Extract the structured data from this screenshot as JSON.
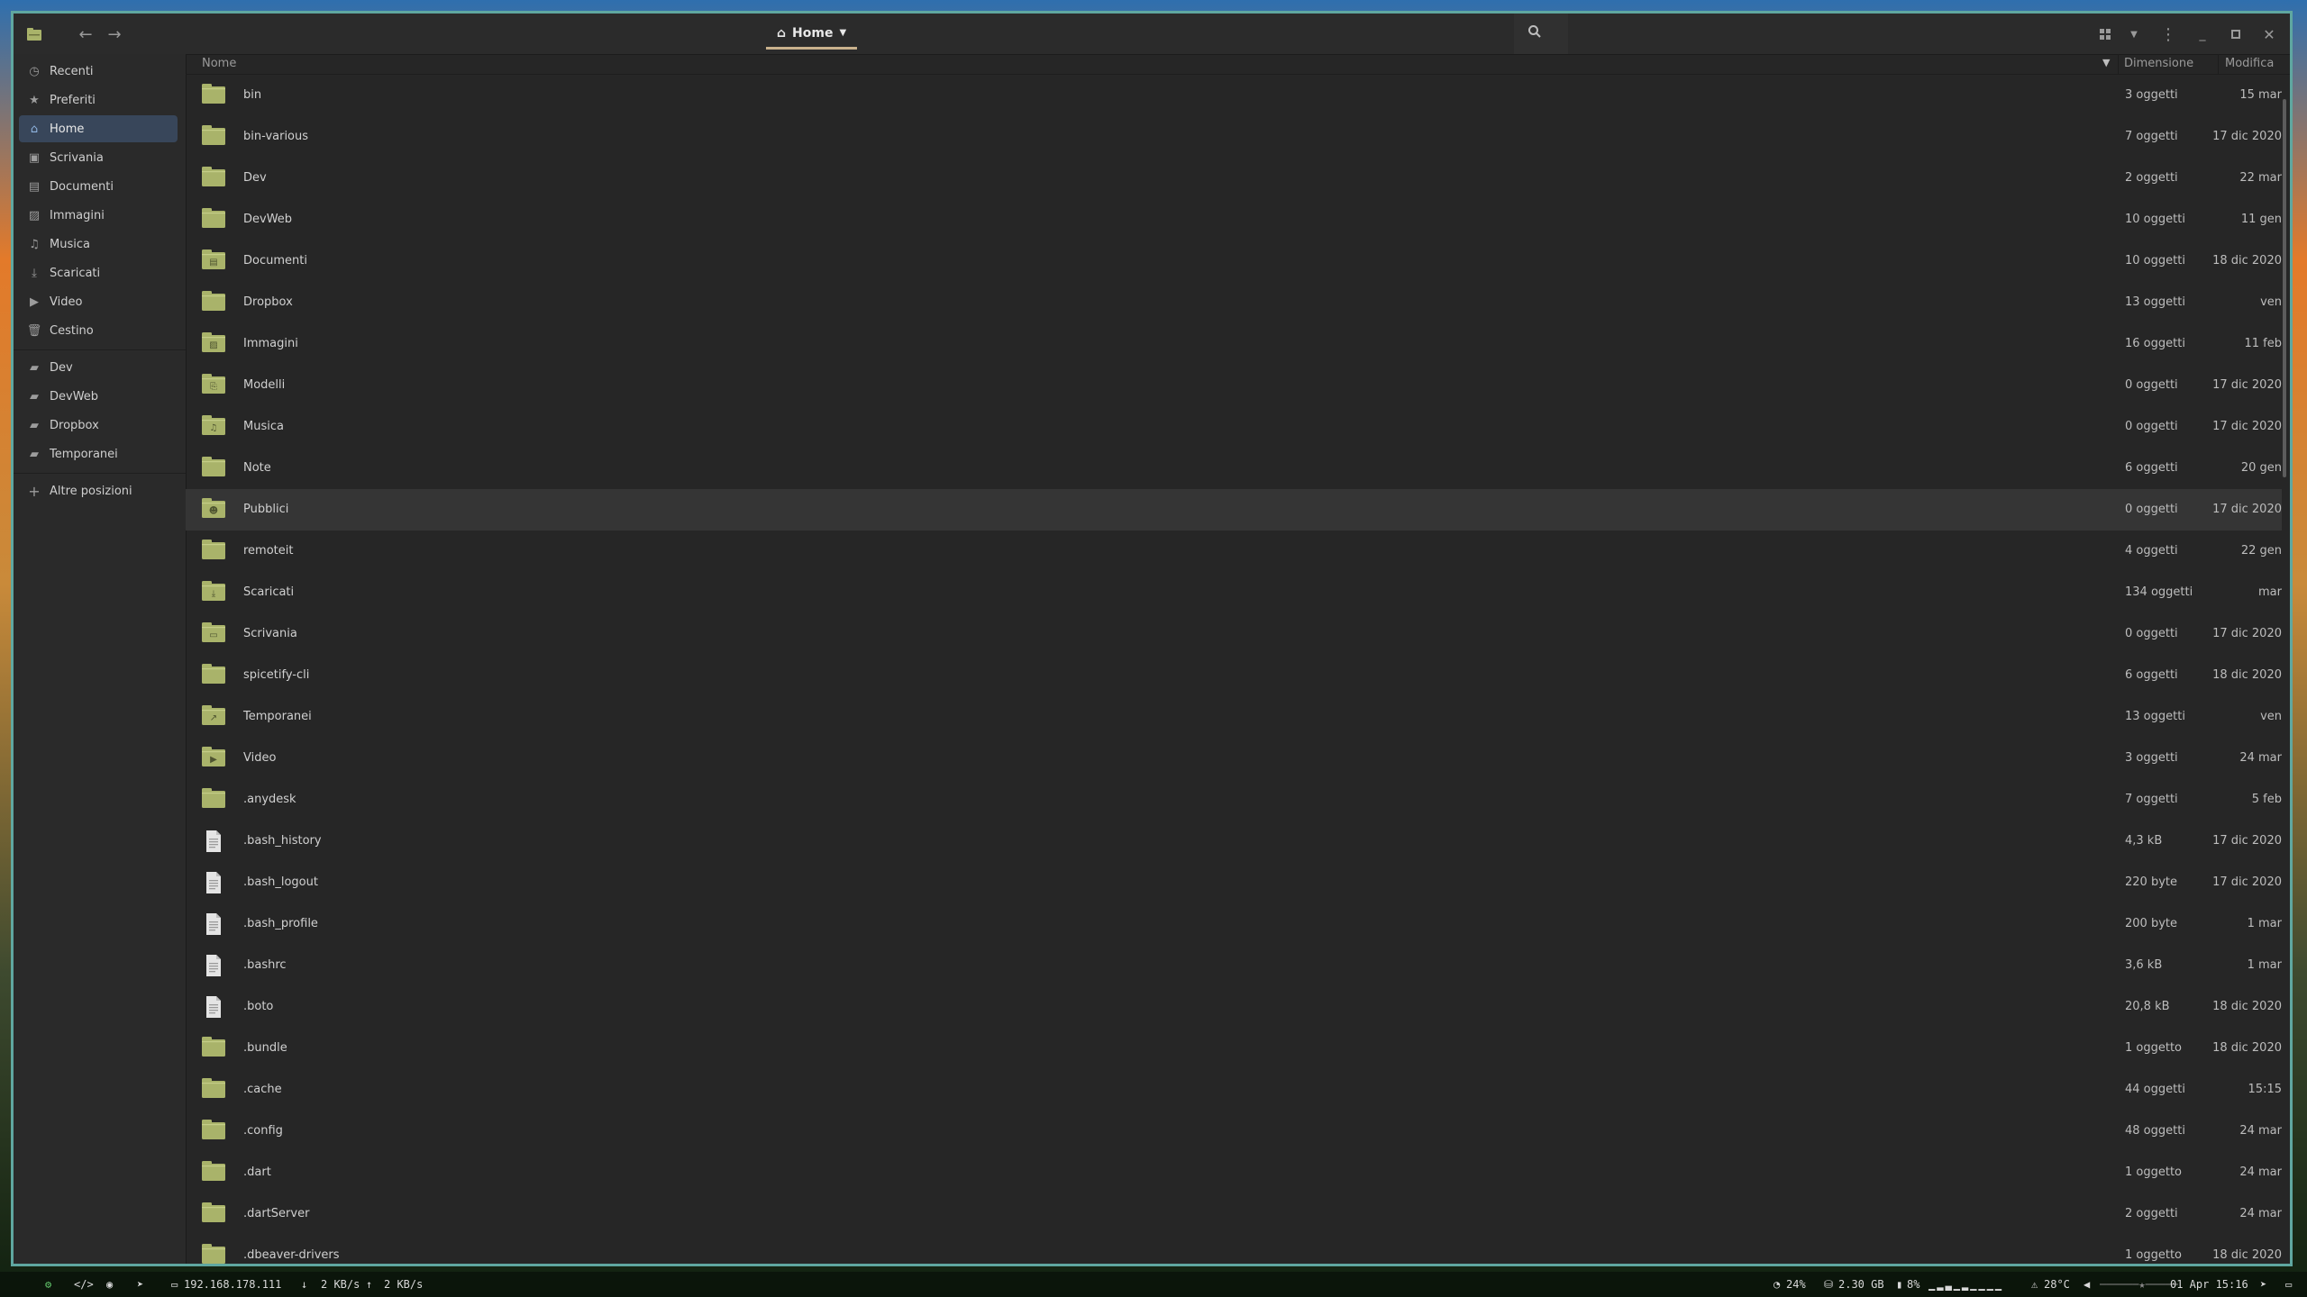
{
  "headerbar": {
    "path_label": "Home",
    "icons": [
      "app-icon",
      "back-icon",
      "forward-icon",
      "chevron-down-icon",
      "search-icon",
      "grid-view-icon",
      "view-options-icon",
      "menu-icon",
      "minimize-icon",
      "maximize-icon",
      "close-icon"
    ]
  },
  "sidebar": {
    "items": [
      {
        "label": "Recenti",
        "icon": "clock-icon"
      },
      {
        "label": "Preferiti",
        "icon": "star-icon"
      },
      {
        "label": "Home",
        "icon": "home-icon",
        "active": true
      },
      {
        "label": "Scrivania",
        "icon": "desktop-icon"
      },
      {
        "label": "Documenti",
        "icon": "document-icon"
      },
      {
        "label": "Immagini",
        "icon": "image-icon"
      },
      {
        "label": "Musica",
        "icon": "music-icon"
      },
      {
        "label": "Scaricati",
        "icon": "download-icon"
      },
      {
        "label": "Video",
        "icon": "video-icon"
      },
      {
        "label": "Cestino",
        "icon": "trash-icon"
      }
    ],
    "bookmarks": [
      {
        "label": "Dev",
        "icon": "folder-icon"
      },
      {
        "label": "DevWeb",
        "icon": "folder-icon"
      },
      {
        "label": "Dropbox",
        "icon": "folder-icon"
      },
      {
        "label": "Temporanei",
        "icon": "folder-icon"
      }
    ],
    "other_locations": "Altre posizioni"
  },
  "columns": {
    "name": "Nome",
    "size": "Dimensione",
    "modified": "Modifica"
  },
  "files": [
    {
      "name": "bin",
      "size": "3 oggetti",
      "modified": "15 mar",
      "type": "folder"
    },
    {
      "name": "bin-various",
      "size": "7 oggetti",
      "modified": "17 dic 2020",
      "type": "folder"
    },
    {
      "name": "Dev",
      "size": "2 oggetti",
      "modified": "22 mar",
      "type": "folder"
    },
    {
      "name": "DevWeb",
      "size": "10 oggetti",
      "modified": "11 gen",
      "type": "folder"
    },
    {
      "name": "Documenti",
      "size": "10 oggetti",
      "modified": "18 dic 2020",
      "type": "folder-documents"
    },
    {
      "name": "Dropbox",
      "size": "13 oggetti",
      "modified": "ven",
      "type": "folder"
    },
    {
      "name": "Immagini",
      "size": "16 oggetti",
      "modified": "11 feb",
      "type": "folder-pictures"
    },
    {
      "name": "Modelli",
      "size": "0 oggetti",
      "modified": "17 dic 2020",
      "type": "folder-templates"
    },
    {
      "name": "Musica",
      "size": "0 oggetti",
      "modified": "17 dic 2020",
      "type": "folder-music"
    },
    {
      "name": "Note",
      "size": "6 oggetti",
      "modified": "20 gen",
      "type": "folder"
    },
    {
      "name": "Pubblici",
      "size": "0 oggetti",
      "modified": "17 dic 2020",
      "type": "folder-public",
      "highlight": true
    },
    {
      "name": "remoteit",
      "size": "4 oggetti",
      "modified": "22 gen",
      "type": "folder"
    },
    {
      "name": "Scaricati",
      "size": "134 oggetti",
      "modified": "mar",
      "type": "folder-download"
    },
    {
      "name": "Scrivania",
      "size": "0 oggetti",
      "modified": "17 dic 2020",
      "type": "folder-desktop"
    },
    {
      "name": "spicetify-cli",
      "size": "6 oggetti",
      "modified": "18 dic 2020",
      "type": "folder"
    },
    {
      "name": "Temporanei",
      "size": "13 oggetti",
      "modified": "ven",
      "type": "folder-link"
    },
    {
      "name": "Video",
      "size": "3 oggetti",
      "modified": "24 mar",
      "type": "folder-video"
    },
    {
      "name": ".anydesk",
      "size": "7 oggetti",
      "modified": "5 feb",
      "type": "folder"
    },
    {
      "name": ".bash_history",
      "size": "4,3 kB",
      "modified": "17 dic 2020",
      "type": "file"
    },
    {
      "name": ".bash_logout",
      "size": "220 byte",
      "modified": "17 dic 2020",
      "type": "file"
    },
    {
      "name": ".bash_profile",
      "size": "200 byte",
      "modified": "1 mar",
      "type": "file"
    },
    {
      "name": ".bashrc",
      "size": "3,6 kB",
      "modified": "1 mar",
      "type": "file"
    },
    {
      "name": ".boto",
      "size": "20,8 kB",
      "modified": "18 dic 2020",
      "type": "file"
    },
    {
      "name": ".bundle",
      "size": "1 oggetto",
      "modified": "18 dic 2020",
      "type": "folder"
    },
    {
      "name": ".cache",
      "size": "44 oggetti",
      "modified": "15:15",
      "type": "folder"
    },
    {
      "name": ".config",
      "size": "48 oggetti",
      "modified": "24 mar",
      "type": "folder"
    },
    {
      "name": ".dart",
      "size": "1 oggetto",
      "modified": "24 mar",
      "type": "folder"
    },
    {
      "name": ".dartServer",
      "size": "2 oggetti",
      "modified": "24 mar",
      "type": "folder"
    },
    {
      "name": ".dbeaver-drivers",
      "size": "1 oggetto",
      "modified": "18 dic 2020",
      "type": "folder"
    }
  ],
  "taskbar": {
    "ip": "192.168.178.111",
    "down": "2 KB/s",
    "up": "2 KB/s",
    "cpu": "24%",
    "disk": "2.30 GB",
    "battery": "8%",
    "temp": "28°C",
    "datetime": "01 Apr 15:16"
  },
  "colors": {
    "folder": "#a9b36a",
    "accent": "#c9b18c",
    "active_sidebar": "#38465a",
    "window_border": "#5fa7a0"
  }
}
